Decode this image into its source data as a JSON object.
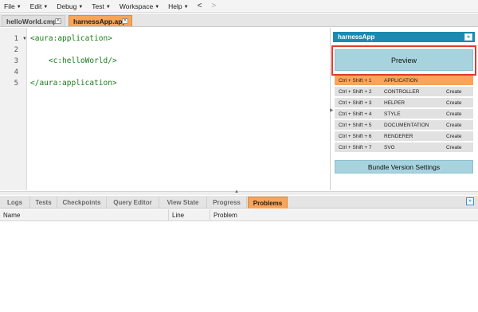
{
  "menubar": {
    "items": [
      "File",
      "Edit",
      "Debug",
      "Test",
      "Workspace",
      "Help"
    ],
    "back": "<",
    "forward": ">"
  },
  "file_tabs": [
    {
      "label": "helloWorld.cmp",
      "active": false
    },
    {
      "label": "harnessApp.app",
      "active": true
    }
  ],
  "editor": {
    "line_numbers": [
      "1",
      "2",
      "3",
      "4",
      "5"
    ],
    "lines": [
      "<aura:application>",
      "",
      "    <c:helloWorld/>",
      "",
      "</aura:application>"
    ]
  },
  "side_panel": {
    "title": "harnessApp",
    "collapse": "»",
    "preview_label": "Preview",
    "bundle": [
      {
        "shortcut": "Ctrl + Shift + 1",
        "name": "APPLICATION",
        "action": "",
        "active": true
      },
      {
        "shortcut": "Ctrl + Shift + 2",
        "name": "CONTROLLER",
        "action": "Create",
        "active": false
      },
      {
        "shortcut": "Ctrl + Shift + 3",
        "name": "HELPER",
        "action": "Create",
        "active": false
      },
      {
        "shortcut": "Ctrl + Shift + 4",
        "name": "STYLE",
        "action": "Create",
        "active": false
      },
      {
        "shortcut": "Ctrl + Shift + 5",
        "name": "DOCUMENTATION",
        "action": "Create",
        "active": false
      },
      {
        "shortcut": "Ctrl + Shift + 6",
        "name": "RENDERER",
        "action": "Create",
        "active": false
      },
      {
        "shortcut": "Ctrl + Shift + 7",
        "name": "SVG",
        "action": "Create",
        "active": false
      }
    ],
    "settings_label": "Bundle Version Settings"
  },
  "bottom_tabs": [
    {
      "label": "Logs",
      "active": false
    },
    {
      "label": "Tests",
      "active": false
    },
    {
      "label": "Checkpoints",
      "active": false
    },
    {
      "label": "Query Editor",
      "active": false
    },
    {
      "label": "View State",
      "active": false
    },
    {
      "label": "Progress",
      "active": false
    },
    {
      "label": "Problems",
      "active": true
    }
  ],
  "problems_table": {
    "columns": [
      "Name",
      "Line",
      "Problem"
    ]
  },
  "colors": {
    "active_tab": "#f8a55a",
    "panel_header": "#1c8ab0",
    "button": "#a7d3df",
    "highlight": "#e23c2e",
    "code_text": "#1a7a1a"
  }
}
